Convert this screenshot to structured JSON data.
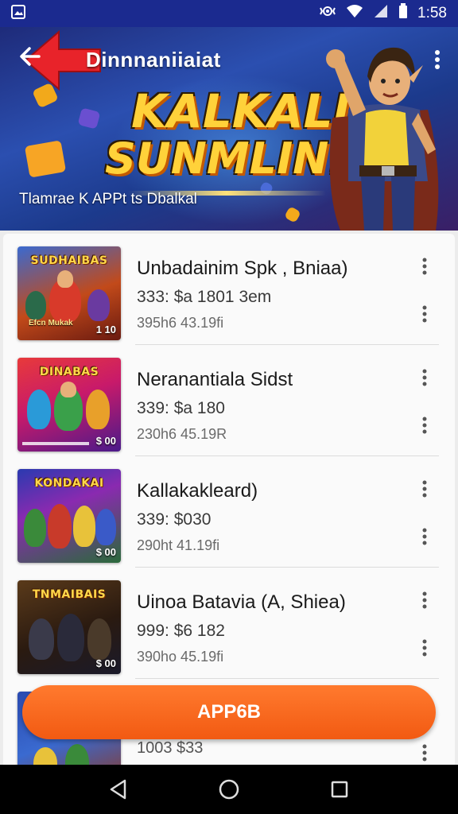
{
  "status_bar": {
    "time": "1:58",
    "icons": [
      "image-icon",
      "vibrate-icon",
      "wifi-icon",
      "signal-icon",
      "battery-icon"
    ]
  },
  "banner": {
    "title": "Dinnnaniiaiat",
    "headline_line1": "KALKALI",
    "headline_line2": "SUNMLIN.!",
    "subtitle": "Tlamrae K APPt ts Dbalkal",
    "icons": [
      "back-arrow-icon",
      "more-vert-icon"
    ]
  },
  "items": [
    {
      "name": "Unbadainim Spk , Bniaa)",
      "price": "333: $a 1801 3em",
      "meta": "395h6 43.19fi",
      "thumb_title": "SUDHAIBAS",
      "thumb_sub": "Efcn Mukak",
      "thumb_price": "1 10"
    },
    {
      "name": "Neranantiala Sidst",
      "price": "339: $a 180",
      "meta": "230h6 45.19R",
      "thumb_title": "DINABAS",
      "thumb_sub": "",
      "thumb_price": "$ 00"
    },
    {
      "name": "Kallakakleard)",
      "price": "339: $030",
      "meta": "290ht 41.19fi",
      "thumb_title": "KONDAKAI",
      "thumb_sub": "",
      "thumb_price": "$ 00"
    },
    {
      "name": "Uinoa Batavia  (A, Shiea)",
      "price": "999: $6 182",
      "meta": "390ho 45.19fi",
      "thumb_title": "TNMAIBAIS",
      "thumb_sub": "",
      "thumb_price": "$ 00"
    },
    {
      "name": "",
      "price": "1003 $33",
      "meta": "",
      "thumb_title": "",
      "thumb_sub": "",
      "thumb_price": ""
    }
  ],
  "cta": {
    "label": "APP6B"
  },
  "colors": {
    "status_bar": "#1b2a8f",
    "cta": "#f25a12",
    "headline": "#ffd23a"
  }
}
